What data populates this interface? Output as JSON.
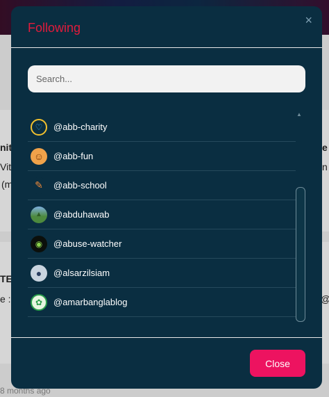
{
  "background": {
    "row1_left": "nit",
    "row1_left2": "Vith",
    "row1_left3": "(m",
    "row1_right": "e",
    "row1_right2": "n",
    "row2_left": "TE",
    "row2_left2": "e :",
    "row2_right": "@",
    "timestamp": "8 months ago"
  },
  "modal": {
    "title": "Following",
    "close_icon": "×",
    "search_placeholder": "Search...",
    "items": [
      {
        "handle": "@abb-charity",
        "avatar_color": "#0a2e41",
        "avatar_glyph": "♡"
      },
      {
        "handle": "@abb-fun",
        "avatar_color": "#f0a24a",
        "avatar_glyph": "☺"
      },
      {
        "handle": "@abb-school",
        "avatar_color": "#0a2e41",
        "avatar_glyph": "✎"
      },
      {
        "handle": "@abduhawab",
        "avatar_color": "#4d8a3e",
        "avatar_glyph": "▲"
      },
      {
        "handle": "@abuse-watcher",
        "avatar_color": "#0b0f0b",
        "avatar_glyph": "◉"
      },
      {
        "handle": "@alsarzilsiam",
        "avatar_color": "#6a8aa8",
        "avatar_glyph": "●"
      },
      {
        "handle": "@amarbanglablog",
        "avatar_color": "#2a9d4a",
        "avatar_glyph": "✿"
      }
    ],
    "close_button": "Close"
  }
}
